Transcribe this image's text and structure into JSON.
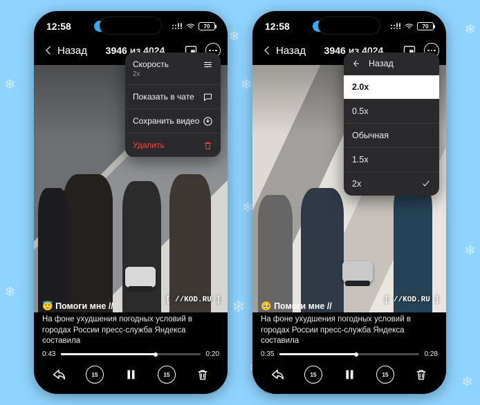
{
  "statusbar": {
    "time": "12:58",
    "app_badge": "TELEGRAM",
    "signal_label": "::!!",
    "wifi_label": "wifi",
    "battery_pct": "70"
  },
  "navbar": {
    "back_label": "Назад",
    "counter": "3946 из 4024"
  },
  "watermark": "[ //KOD.RU ]",
  "caption": {
    "emoji_one": "😇",
    "emoji_two": "🥺",
    "headline": "Помоги мне //",
    "body": "На фоне ухудшения погодных условий в городах России пресс-служба Яндекса составила"
  },
  "playback_left": {
    "elapsed": "0:43",
    "remaining": "0:20",
    "progress_pct": 68
  },
  "playback_right": {
    "elapsed": "0:35",
    "remaining": "0:28",
    "progress_pct": 55
  },
  "skip_seconds": "15",
  "settings_menu": {
    "speed_label": "Скорость",
    "speed_value": "2x",
    "show_in_chat": "Показать в чате",
    "save_video": "Сохранить видео",
    "delete": "Удалить"
  },
  "speed_picker": {
    "back": "Назад",
    "selected": "2.0x",
    "options": [
      "0.5x",
      "Обычная",
      "1.5x",
      "2x"
    ]
  }
}
